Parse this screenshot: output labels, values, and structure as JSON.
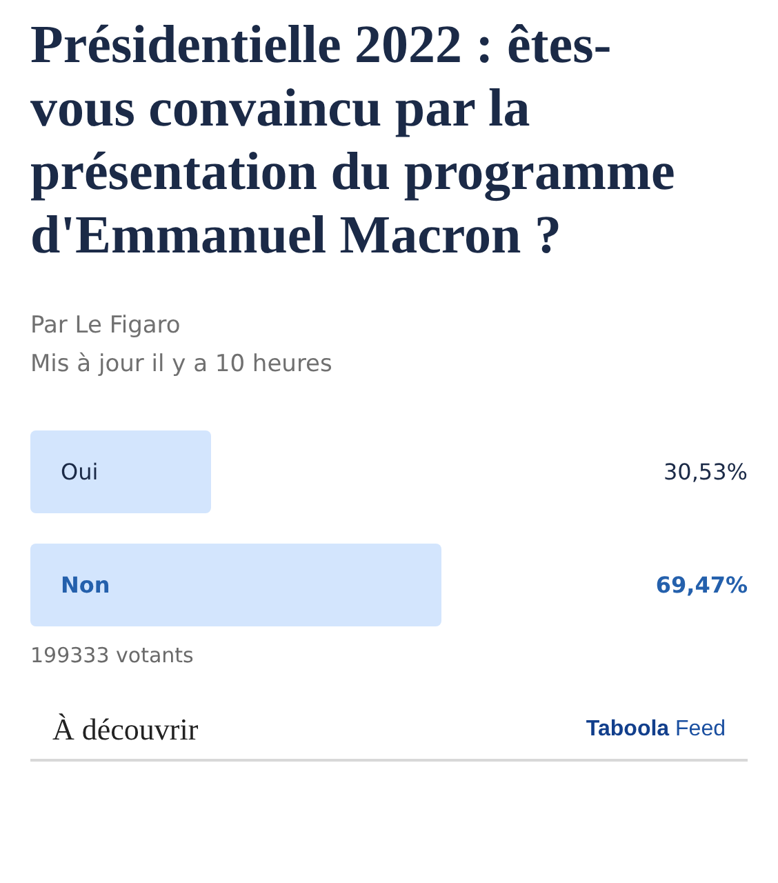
{
  "title": "Présidentielle 2022 : êtes-vous convaincu par la présentation du programme d'Emmanuel Macron ?",
  "byline": "Par Le Figaro",
  "updated": "Mis à jour il y a 10 heures",
  "options": [
    {
      "label": "Oui",
      "reading": "30,53%",
      "leading": false
    },
    {
      "label": "Non",
      "reading": "69,47%",
      "leading": true
    }
  ],
  "votes": "199333 votants",
  "footer": {
    "heading": "À découvrir",
    "brand": "Taboola",
    "brand_suffix": "Feed"
  }
}
